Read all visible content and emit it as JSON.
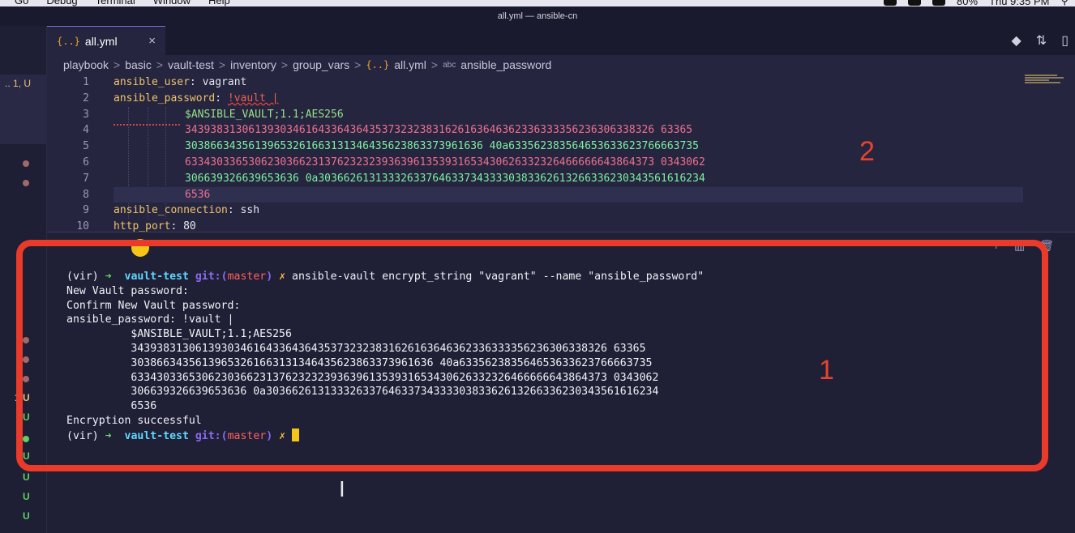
{
  "menubar": {
    "items": [
      "Go",
      "Debug",
      "Terminal",
      "Window",
      "Help"
    ],
    "battery": "80%",
    "clock": "Thu 9:35 PM"
  },
  "window": {
    "title": "all.yml — ansible-cn"
  },
  "explorer": {
    "status": ".. 1, U",
    "markers": [
      "1 U",
      "U",
      "U",
      "U",
      "U",
      "U"
    ]
  },
  "tab": {
    "icon": "{..}",
    "label": "all.yml",
    "close": "×"
  },
  "breadcrumb": {
    "parts": [
      "playbook",
      "basic",
      "vault-test",
      "inventory",
      "group_vars"
    ],
    "file_icon": "{..}",
    "file": "all.yml",
    "symbol_icon": "abc",
    "symbol": "ansible_password"
  },
  "editor": {
    "line_numbers": [
      "1",
      "2",
      "3",
      "4",
      "5",
      "6",
      "7",
      "8",
      "9",
      "10"
    ],
    "l1_key": "ansible_user",
    "l1_val": " vagrant",
    "l2_key": "ansible_password",
    "l2_tag": "!vault |",
    "l3": "$ANSIBLE_VAULT;1.1;AES256",
    "l4": "34393831306139303461643364364353732323831626163646362336333356236306338326 63365",
    "l5": "30386634356139653261663131346435623863373961636 40a633562383564653633623766663735",
    "l6": "63343033653062303662313762323239363961353931653430626332326466666643864373 0343062",
    "l7": "306639326639653636 0a3036626131333263376463373433330383362613266336230343561616234",
    "l8": "6536",
    "l9_key": "ansible_connection",
    "l9_val": " ssh",
    "l10_key": "http_port",
    "l10_val": " 80"
  },
  "annotations": {
    "label_editor": "2",
    "label_terminal": "1"
  },
  "terminal": {
    "prompt_env": "(vir)",
    "prompt_arrow": "➜",
    "prompt_dir": "vault-test",
    "prompt_git": "git:(",
    "prompt_branch": "master",
    "prompt_git_close": ")",
    "prompt_x": "✗",
    "command": "ansible-vault encrypt_string \"vagrant\" --name \"ansible_password\"",
    "out1": "New Vault password:",
    "out2": "Confirm New Vault password:",
    "out3": "ansible_password: !vault |",
    "out4": "          $ANSIBLE_VAULT;1.1;AES256",
    "out5": "          34393831306139303461643364364353732323831626163646362336333356236306338326 63365",
    "out6": "          30386634356139653261663131346435623863373961636 40a633562383564653633623766663735",
    "out7": "          63343033653062303662313762323239363961353931653430626332326466666643864373 0343062",
    "out8": "          306639326639653636 0a3036626131333263376463373433330383362613266336230343561616234",
    "out9": "          6536",
    "out10": "Encryption successful"
  },
  "colors": {
    "annotation": "#ea3a2a",
    "cursor": "#f5c518",
    "accent": "#6f6fd0"
  }
}
